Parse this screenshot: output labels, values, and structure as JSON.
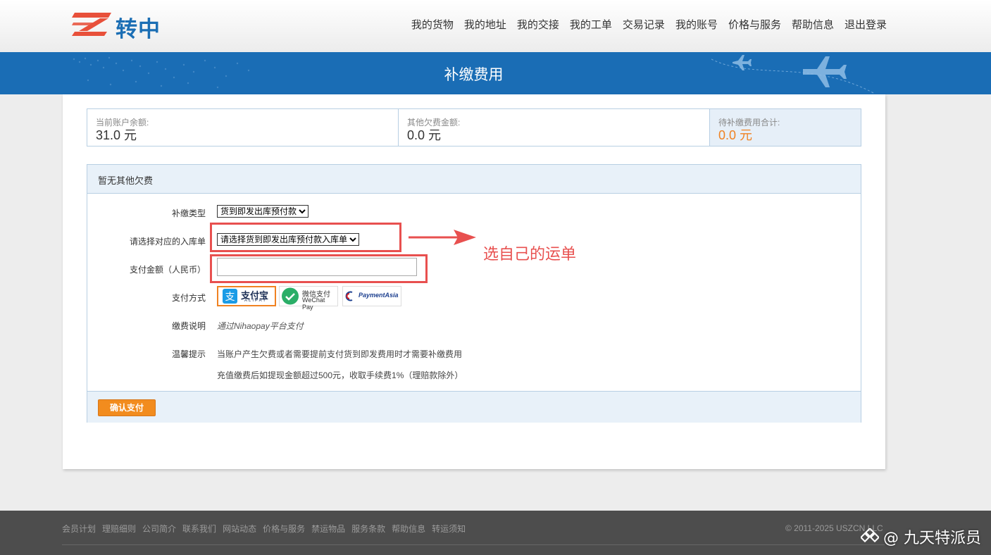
{
  "brand": {
    "name": "转中",
    "logo_color": "#1b6eb4",
    "mark_color": "#e8503a"
  },
  "nav": [
    {
      "label": "我的货物"
    },
    {
      "label": "我的地址"
    },
    {
      "label": "我的交接"
    },
    {
      "label": "我的工单"
    },
    {
      "label": "交易记录"
    },
    {
      "label": "我的账号"
    },
    {
      "label": "价格与服务"
    },
    {
      "label": "帮助信息"
    },
    {
      "label": "退出登录"
    }
  ],
  "banner": {
    "title": "补缴费用",
    "bg": "#1a6db5"
  },
  "summary": {
    "balance_label": "当前账户余额:",
    "balance_value": "31.0 元",
    "other_label": "其他欠费金额:",
    "other_value": "0.0 元",
    "total_label": "待补缴费用合计:",
    "total_value": "0.0 元"
  },
  "form": {
    "header": "暂无其他欠费",
    "type_label": "补缴类型",
    "type_selected": "货到即发出库预付款",
    "order_label": "请选择对应的入库单",
    "order_selected": "请选择货到即发出库预付款入库单",
    "amount_label": "支付金额（人民币）",
    "amount_value": "",
    "method_label": "支付方式",
    "methods": [
      {
        "name": "alipay",
        "label": "支付宝",
        "sub": "ALIPAY",
        "selected": true
      },
      {
        "name": "wechat",
        "label": "微信支付",
        "sub": "WeChat Pay",
        "selected": false
      },
      {
        "name": "paymentasia",
        "label": "PaymentAsia",
        "selected": false
      }
    ],
    "desc_label": "缴费说明",
    "desc_value": "通过Nihaopay平台支付",
    "tip_label": "温馨提示",
    "tip_line1": "当账户产生欠费或者需要提前支付货到即发费用时才需要补缴费用",
    "tip_line2": "充值缴费后如提现金额超过500元，收取手续费1%（理赔款除外）",
    "submit": "确认支付"
  },
  "annotation": {
    "text": "选自己的运单",
    "color": "#e8504f"
  },
  "footer": {
    "links": [
      {
        "label": "会员计划"
      },
      {
        "label": "理赔细则"
      },
      {
        "label": "公司简介"
      },
      {
        "label": "联系我们"
      },
      {
        "label": "网站动态"
      },
      {
        "label": "价格与服务"
      },
      {
        "label": "禁运物品"
      },
      {
        "label": "服务条款"
      },
      {
        "label": "帮助信息"
      },
      {
        "label": "转运须知"
      }
    ],
    "copyright": "© 2011-2025 USZCN LLC"
  },
  "watermark": "@ 九天特派员"
}
